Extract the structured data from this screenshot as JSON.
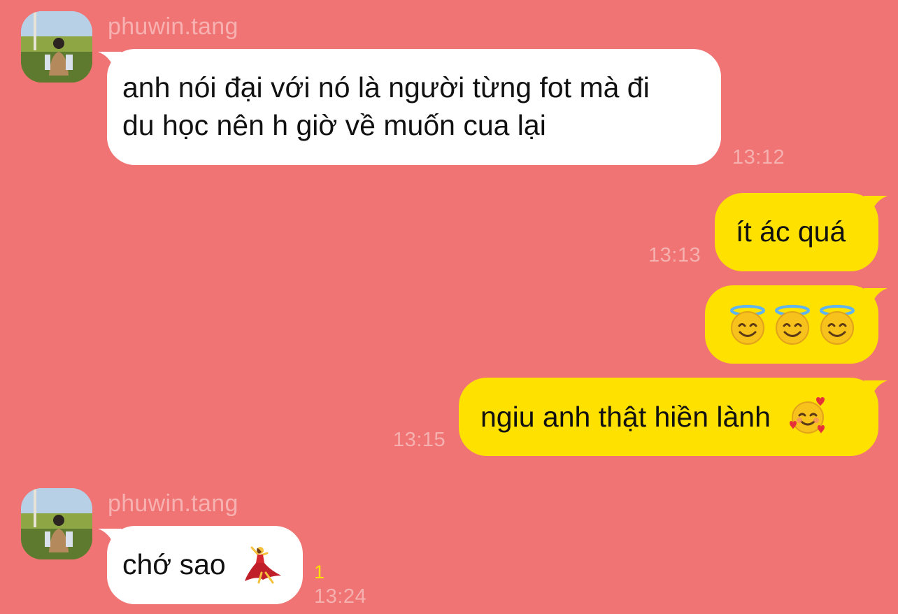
{
  "colors": {
    "background": "#f07474",
    "incoming_bubble": "#ffffff",
    "outgoing_bubble": "#ffe100",
    "meta_text": "#f5b0b0",
    "unread_indicator": "#ffe100"
  },
  "messages": [
    {
      "direction": "incoming",
      "sender": "phuwin.tang",
      "avatar_icon": "profile-photo-avatar",
      "lines": [
        "anh nói đại với nó là người từng fot mà đi",
        "du học nên h giờ về muốn cua lại"
      ],
      "time": "13:12"
    },
    {
      "direction": "outgoing",
      "text": "ít ác quá",
      "time": "13:13"
    },
    {
      "direction": "outgoing",
      "emoji_icons": [
        "smiling-face-with-halo-icon",
        "smiling-face-with-halo-icon",
        "smiling-face-with-halo-icon"
      ]
    },
    {
      "direction": "outgoing",
      "text": "ngiu anh thật hiền lành",
      "emoji_icon": "smiling-face-with-hearts-icon",
      "time": "13:15"
    },
    {
      "direction": "incoming",
      "sender": "phuwin.tang",
      "avatar_icon": "profile-photo-avatar",
      "text": "chớ sao",
      "emoji_icon": "woman-dancing-icon",
      "unread_count": "1",
      "time": "13:24"
    }
  ]
}
